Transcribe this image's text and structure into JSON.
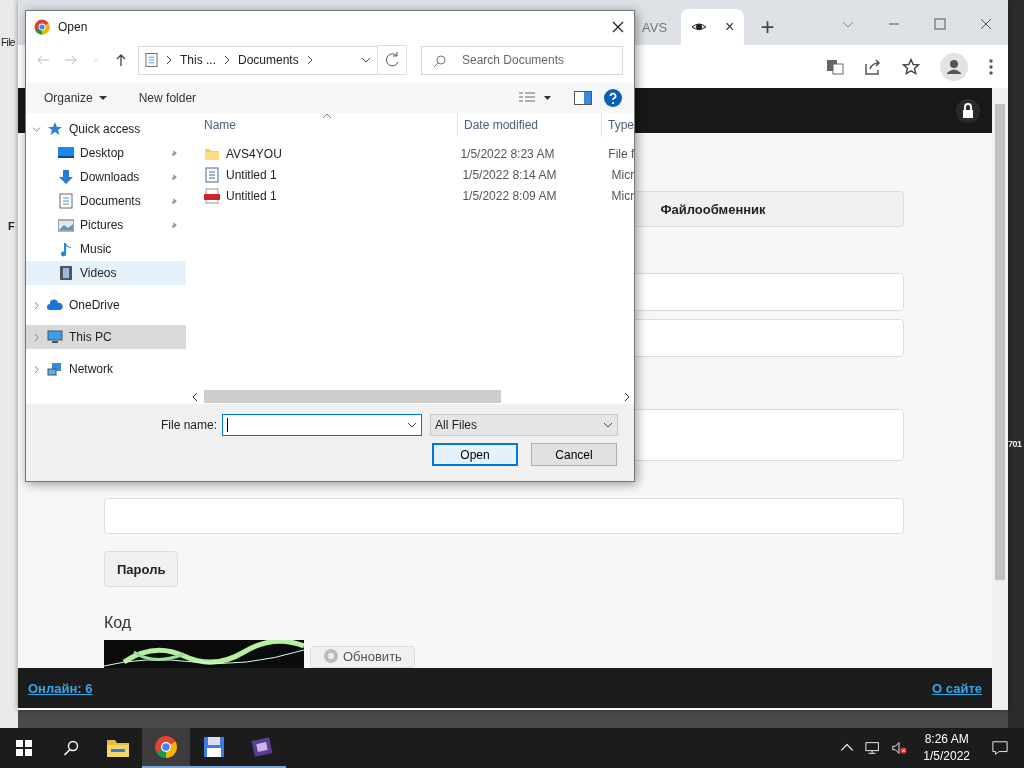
{
  "desktop": {
    "left_label": "File",
    "left_letter": "F",
    "right_label": "701"
  },
  "browser": {
    "tabs": [
      {
        "label": "AVS",
        "selected": false
      },
      {
        "close": "×",
        "selected": true
      }
    ],
    "new_tab": "+",
    "page": {
      "share_button": "Файлообменник",
      "password_button": "Пароль",
      "code_label": "Код",
      "refresh_button": "Обновить",
      "footer": {
        "online": "Онлайн: 6",
        "about": "О сайте"
      }
    }
  },
  "dialog": {
    "title": "Open",
    "breadcrumb": [
      "This ...",
      "Documents"
    ],
    "search": {
      "placeholder": "Search Documents"
    },
    "commands": [
      {
        "label": "Organize",
        "dropdown": true
      },
      {
        "label": "New folder",
        "dropdown": false
      }
    ],
    "columns": [
      "Name",
      "Date modified",
      "Type"
    ],
    "nav": [
      {
        "label": "Quick access",
        "kind": "star",
        "expanded": true,
        "selected": false,
        "children": [
          {
            "label": "Desktop",
            "kind": "desktop",
            "pinned": true,
            "selected": false
          },
          {
            "label": "Downloads",
            "kind": "download",
            "pinned": true,
            "selected": false
          },
          {
            "label": "Documents",
            "kind": "document",
            "pinned": true,
            "selected": false
          },
          {
            "label": "Pictures",
            "kind": "pictures",
            "pinned": true,
            "selected": false
          },
          {
            "label": "Music",
            "kind": "music",
            "pinned": false,
            "selected": false
          },
          {
            "label": "Videos",
            "kind": "videos",
            "pinned": false,
            "selected": true
          }
        ]
      },
      {
        "label": "OneDrive",
        "kind": "cloud",
        "expanded": false,
        "selected": false
      },
      {
        "label": "This PC",
        "kind": "computer",
        "expanded": false,
        "selected": true
      },
      {
        "label": "Network",
        "kind": "network",
        "expanded": false,
        "selected": false
      }
    ],
    "files": [
      {
        "name": "AVS4YOU",
        "date": "1/5/2022 8:23 AM",
        "type": "File f",
        "kind": "folder"
      },
      {
        "name": "Untitled 1",
        "date": "1/5/2022 8:14 AM",
        "type": "Micr",
        "kind": "doc"
      },
      {
        "name": "Untitled 1",
        "date": "1/5/2022 8:09 AM",
        "type": "Micr",
        "kind": "pdf"
      }
    ],
    "file_name_label": "File name:",
    "filter": "All Files",
    "buttons": [
      {
        "label": "Open",
        "default": true
      },
      {
        "label": "Cancel",
        "default": false
      }
    ]
  },
  "taskbar": {
    "apps": [
      {
        "kind": "explorer",
        "selected": false,
        "running": false
      },
      {
        "kind": "chrome",
        "selected": true,
        "running": true
      },
      {
        "kind": "floppy",
        "selected": false,
        "running": true
      },
      {
        "kind": "film",
        "selected": false,
        "running": true
      }
    ],
    "time": "8:26 AM",
    "date": "1/5/2022"
  }
}
